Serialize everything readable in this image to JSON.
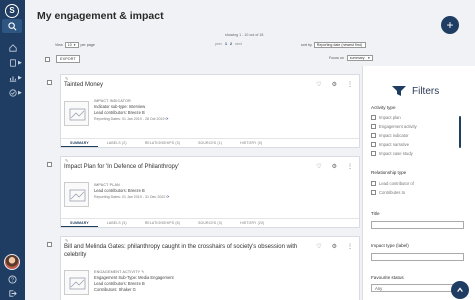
{
  "page": {
    "title": "My engagement & impact"
  },
  "toolbar": {
    "showing": "showing 1 - 10 out of 18",
    "view_label": "View",
    "view_value": "10",
    "per_page": "per page",
    "prev": "prev",
    "page1": "1",
    "page2": "2",
    "next": "next",
    "sort_label": "sort by",
    "sort_value": "Reporting date (newest first)",
    "export": "EXPORT",
    "focus_label": "Focus on",
    "focus_value": "summary"
  },
  "cards": [
    {
      "title": "Tainted Money",
      "kind": "IMPACT INDICATOR",
      "line1": "Indicator sub-type: Interview",
      "line2": "Lead contributors: Breeze B",
      "date": "Reporting Dates: 01 Jan 2019 - 28 Oct 2019",
      "tabs": [
        "SUMMARY",
        "LABELS (2)",
        "RELATIONSHIPS (3)",
        "SOURCES (1)",
        "HISTORY (0)"
      ]
    },
    {
      "title": "Impact Plan for 'In Defence of Philanthropy'",
      "kind": "IMPACT PLAN",
      "line1": "Lead contributors: Breeze B",
      "date": "Reporting Dates: 01 Jan 2019 - 31 Dec 2022",
      "tabs": [
        "SUMMARY",
        "LABELS (3)",
        "RELATIONSHIPS (8)",
        "SOURCES (3)",
        "HISTORY (20)"
      ]
    },
    {
      "title": "Bill and Melinda Gates: philanthropy caught in the crosshairs of society's obsession with celebrity",
      "kind": "ENGAGEMENT ACTIVITY",
      "line1": "Engagement Sub-Type: Media Engagement",
      "line2": "Lead contributors: Breeze B",
      "line3": "Contributors: Shaker G"
    }
  ],
  "filters": {
    "title": "Filters",
    "activity_type": "Activity type",
    "activity_opts": [
      "Impact plan",
      "Engagement activity",
      "Impact indicator",
      "Impact narrative",
      "Impact case study"
    ],
    "relationship_type": "Relationship type",
    "relationship_opts": [
      "Lead contributor of",
      "Contributes to"
    ],
    "title_label": "Title",
    "impact_type": "Impact type (label)",
    "favourite": "Favourite status",
    "favourite_value": "Any"
  },
  "icons": {
    "brand": "slate-s-logo",
    "search": "search-icon",
    "filter": "filter-icon",
    "add": "plus-icon"
  },
  "colors": {
    "accent": "#1f3d63"
  }
}
